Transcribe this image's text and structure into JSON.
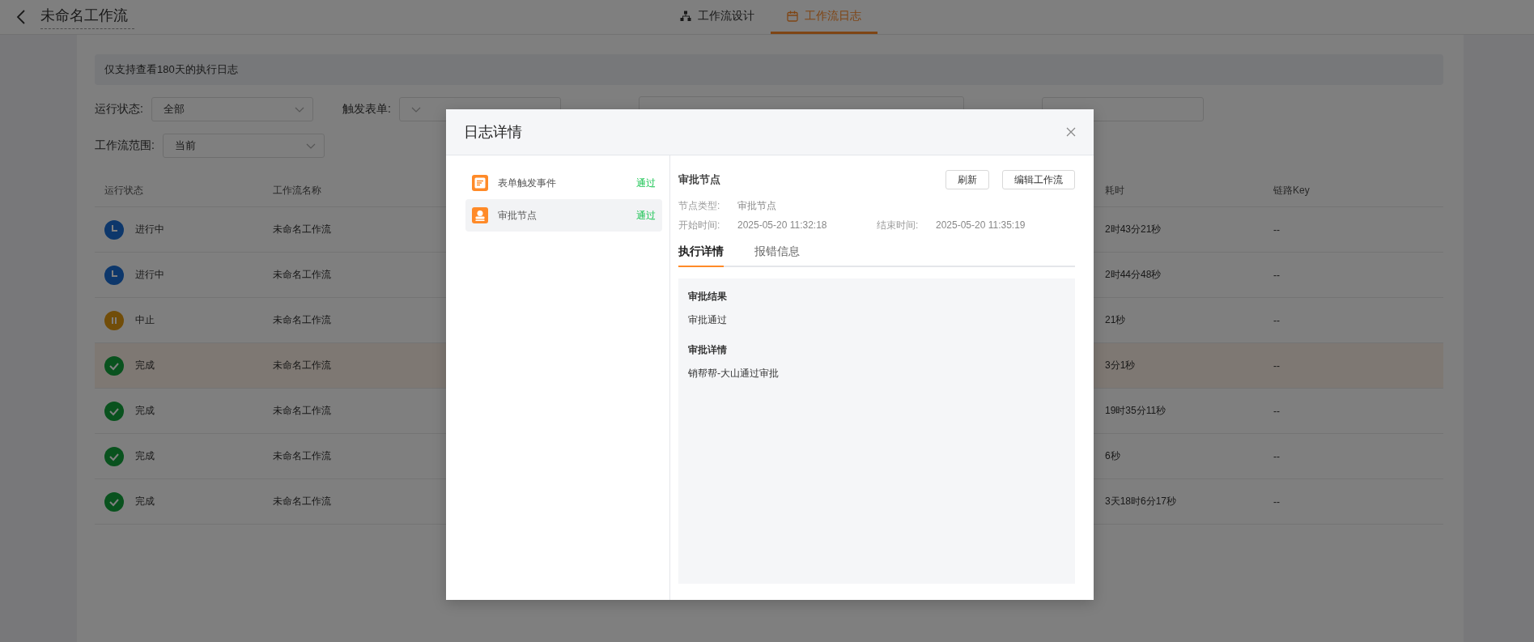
{
  "header": {
    "title": "未命名工作流",
    "tabs": [
      {
        "label": "工作流设计",
        "kind": "design",
        "selected": false
      },
      {
        "label": "工作流日志",
        "kind": "log",
        "selected": true
      }
    ]
  },
  "notice": "仅支持查看180天的执行日志",
  "filters": [
    {
      "kind": "select",
      "label": "运行状态:",
      "value": "全部"
    },
    {
      "kind": "select",
      "label": "触发表单:"
    },
    {
      "kind": "range"
    },
    {
      "kind": "search"
    },
    {
      "kind": "select",
      "label": "工作流范围:",
      "value": "当前"
    }
  ],
  "table": {
    "columns": [
      "运行状态",
      "工作流名称",
      "耗时",
      "链路Key"
    ],
    "rows": [
      {
        "kind": "running",
        "status": "进行中",
        "name": "未命名工作流",
        "duration": "2时43分21秒",
        "key": "--",
        "selected": false
      },
      {
        "kind": "running",
        "status": "进行中",
        "name": "未命名工作流",
        "duration": "2时44分48秒",
        "key": "--",
        "selected": false
      },
      {
        "kind": "paused",
        "status": "中止",
        "name": "未命名工作流",
        "duration": "21秒",
        "key": "--",
        "selected": false
      },
      {
        "kind": "done",
        "status": "完成",
        "name": "未命名工作流",
        "duration": "3分1秒",
        "key": "--",
        "selected": true
      },
      {
        "kind": "done",
        "status": "完成",
        "name": "未命名工作流",
        "duration": "19时35分11秒",
        "key": "--",
        "selected": false
      },
      {
        "kind": "done",
        "status": "完成",
        "name": "未命名工作流",
        "duration": "6秒",
        "key": "--",
        "selected": false
      },
      {
        "kind": "done",
        "status": "完成",
        "name": "未命名工作流",
        "duration": "3天18时6分17秒",
        "key": "--",
        "selected": false
      }
    ]
  },
  "dialog": {
    "title": "日志详情",
    "nodes": [
      {
        "kind": "form",
        "label": "表单触发事件",
        "result": "通过",
        "selected": false
      },
      {
        "kind": "approval",
        "label": "审批节点",
        "result": "通过",
        "selected": true
      }
    ],
    "detail": {
      "title": "审批节点",
      "buttons": [
        "刷新",
        "编辑工作流"
      ],
      "fields": [
        {
          "label": "节点类型:",
          "value": "审批节点"
        }
      ],
      "times": [
        {
          "label": "开始时间:",
          "value": "2025-05-20 11:32:18"
        },
        {
          "label": "结束时间:",
          "value": "2025-05-20 11:35:19"
        }
      ],
      "tabs": [
        {
          "label": "执行详情",
          "selected": true
        },
        {
          "label": "报错信息",
          "selected": false
        }
      ],
      "sections": [
        {
          "heading": "审批结果",
          "text": "审批通过"
        },
        {
          "heading": "审批详情",
          "text": "销帮帮-大山通过审批"
        }
      ]
    }
  }
}
